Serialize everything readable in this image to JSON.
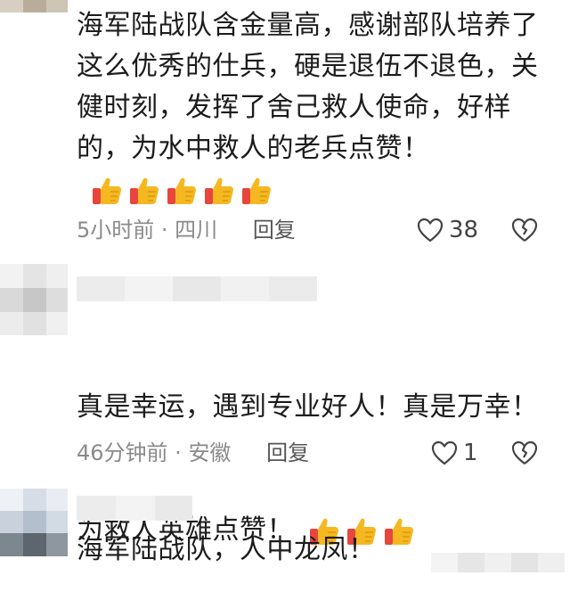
{
  "comments": [
    {
      "text": "海军陆战队含金量高，感谢部队培养了这么优秀的仕兵，硬是退伍不退色，关健时刻，发挥了舍己救人使命，好样的，为水中救人的老兵点赞！",
      "emoji_count": 5,
      "time": "5小时前",
      "location": "四川",
      "reply": "回复",
      "likes": "38"
    },
    {
      "line1": "真是幸运，遇到专业好人！真是万幸！",
      "line2": "为救人英雄点赞！",
      "emoji_count": 3,
      "time": "46分钟前",
      "location": "安徽",
      "reply": "回复",
      "likes": "1"
    },
    {
      "text": "海军陆战队，人中龙凤！"
    }
  ],
  "meta_separator": " · ",
  "icons": {
    "like": "heart-outline-icon",
    "dislike": "broken-heart-icon",
    "emoji": "thumbs-up-emoji"
  },
  "colors": {
    "meta": "#8a8a8a",
    "thumb": "#f5b821",
    "thumb_cuff": "#e8453c"
  }
}
